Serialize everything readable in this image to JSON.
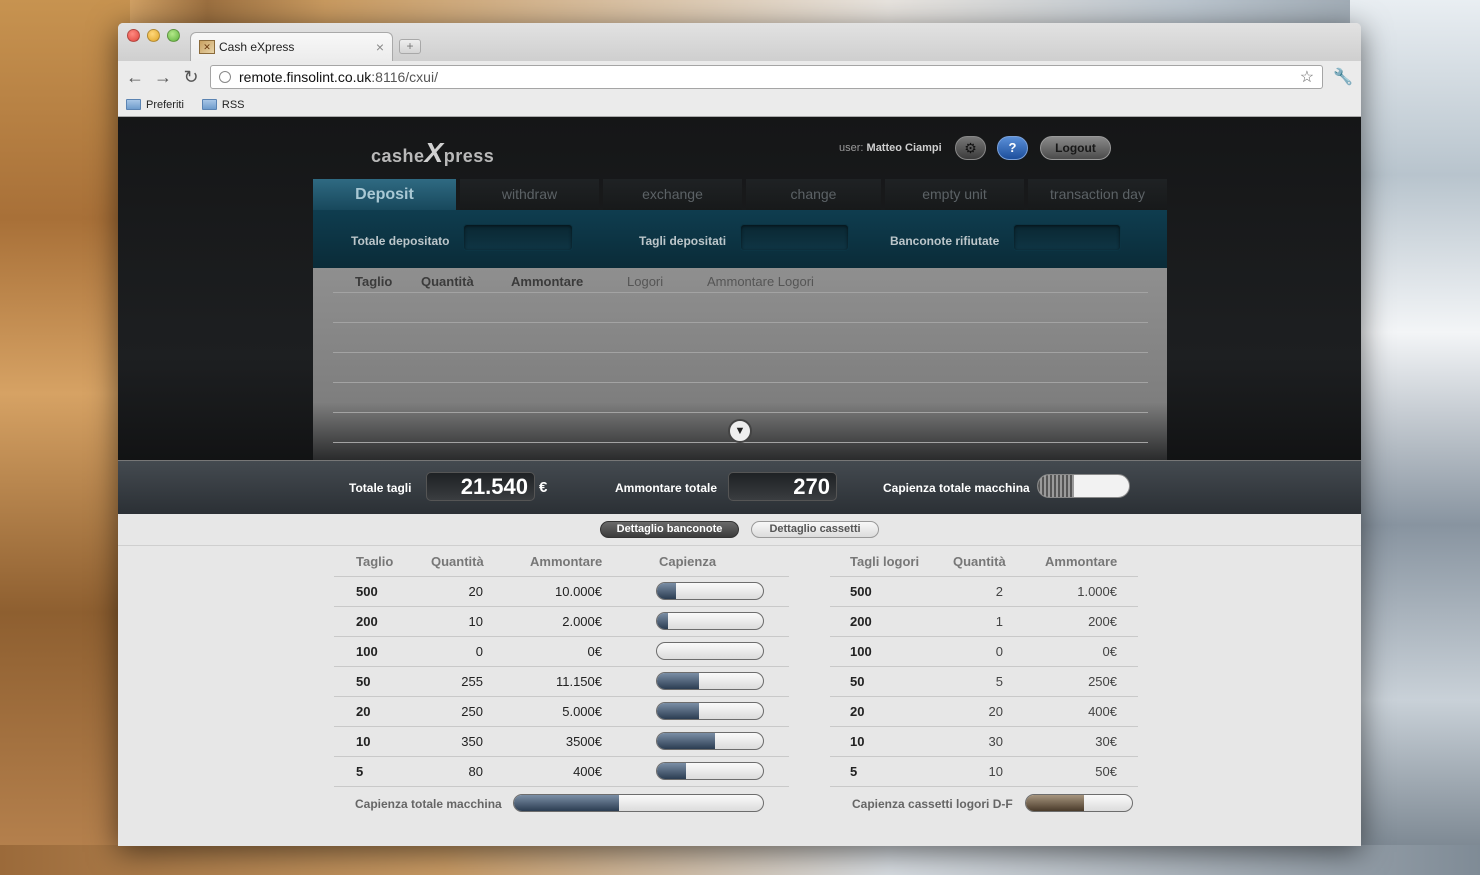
{
  "browser": {
    "tab_title": "Cash eXpress",
    "url_host": "remote.finsolint.co.uk",
    "url_rest": ":8116/cxui/",
    "bookmarks": [
      "Preferiti",
      "RSS"
    ]
  },
  "app": {
    "logo_pre": "cashe",
    "logo_x": "X",
    "logo_post": "press",
    "user_label": "user:",
    "user_name": "Matteo Ciampi",
    "help_label": "?",
    "logout_label": "Logout",
    "tabs": [
      "Deposit",
      "withdraw",
      "exchange",
      "change",
      "empty unit",
      "transaction day"
    ],
    "deposit_fields": {
      "totale_label": "Totale depositato",
      "tagli_label": "Tagli depositati",
      "rifiutate_label": "Banconote rifiutate"
    },
    "deposit_table_headers": [
      "Taglio",
      "Quantità",
      "Ammontare",
      "Logori",
      "Ammontare Logori"
    ],
    "summary": {
      "totale_tagli_label": "Totale tagli",
      "totale_tagli_value": "21.540",
      "euro": "€",
      "ammontare_totale_label": "Ammontare totale",
      "ammontare_totale_value": "270",
      "capienza_label": "Capienza totale macchina",
      "capienza_fraction": 0.4
    },
    "segments": {
      "banconote": "Dettaglio banconote",
      "cassetti": "Dettaglio cassetti"
    },
    "left_table": {
      "headers": [
        "Taglio",
        "Quantità",
        "Ammontare",
        "Capienza"
      ],
      "rows": [
        {
          "taglio": "500",
          "quantita": "20",
          "ammontare": "10.000€",
          "capienza": 0.18
        },
        {
          "taglio": "200",
          "quantita": "10",
          "ammontare": "2.000€",
          "capienza": 0.1
        },
        {
          "taglio": "100",
          "quantita": "0",
          "ammontare": "0€",
          "capienza": 0.0
        },
        {
          "taglio": "50",
          "quantita": "255",
          "ammontare": "11.150€",
          "capienza": 0.4
        },
        {
          "taglio": "20",
          "quantita": "250",
          "ammontare": "5.000€",
          "capienza": 0.4
        },
        {
          "taglio": "10",
          "quantita": "350",
          "ammontare": "3500€",
          "capienza": 0.55
        },
        {
          "taglio": "5",
          "quantita": "80",
          "ammontare": "400€",
          "capienza": 0.27
        }
      ],
      "footer_label": "Capienza totale macchina",
      "footer_fraction": 0.42
    },
    "right_table": {
      "headers": [
        "Tagli logori",
        "Quantità",
        "Ammontare"
      ],
      "rows": [
        {
          "taglio": "500",
          "quantita": "2",
          "ammontare": "1.000€"
        },
        {
          "taglio": "200",
          "quantita": "1",
          "ammontare": "200€"
        },
        {
          "taglio": "100",
          "quantita": "0",
          "ammontare": "0€"
        },
        {
          "taglio": "50",
          "quantita": "5",
          "ammontare": "250€"
        },
        {
          "taglio": "20",
          "quantita": "20",
          "ammontare": "400€"
        },
        {
          "taglio": "10",
          "quantita": "30",
          "ammontare": "30€"
        },
        {
          "taglio": "5",
          "quantita": "10",
          "ammontare": "50€"
        }
      ],
      "footer_label": "Capienza cassetti logori D-F",
      "footer_fraction": 0.55
    }
  }
}
